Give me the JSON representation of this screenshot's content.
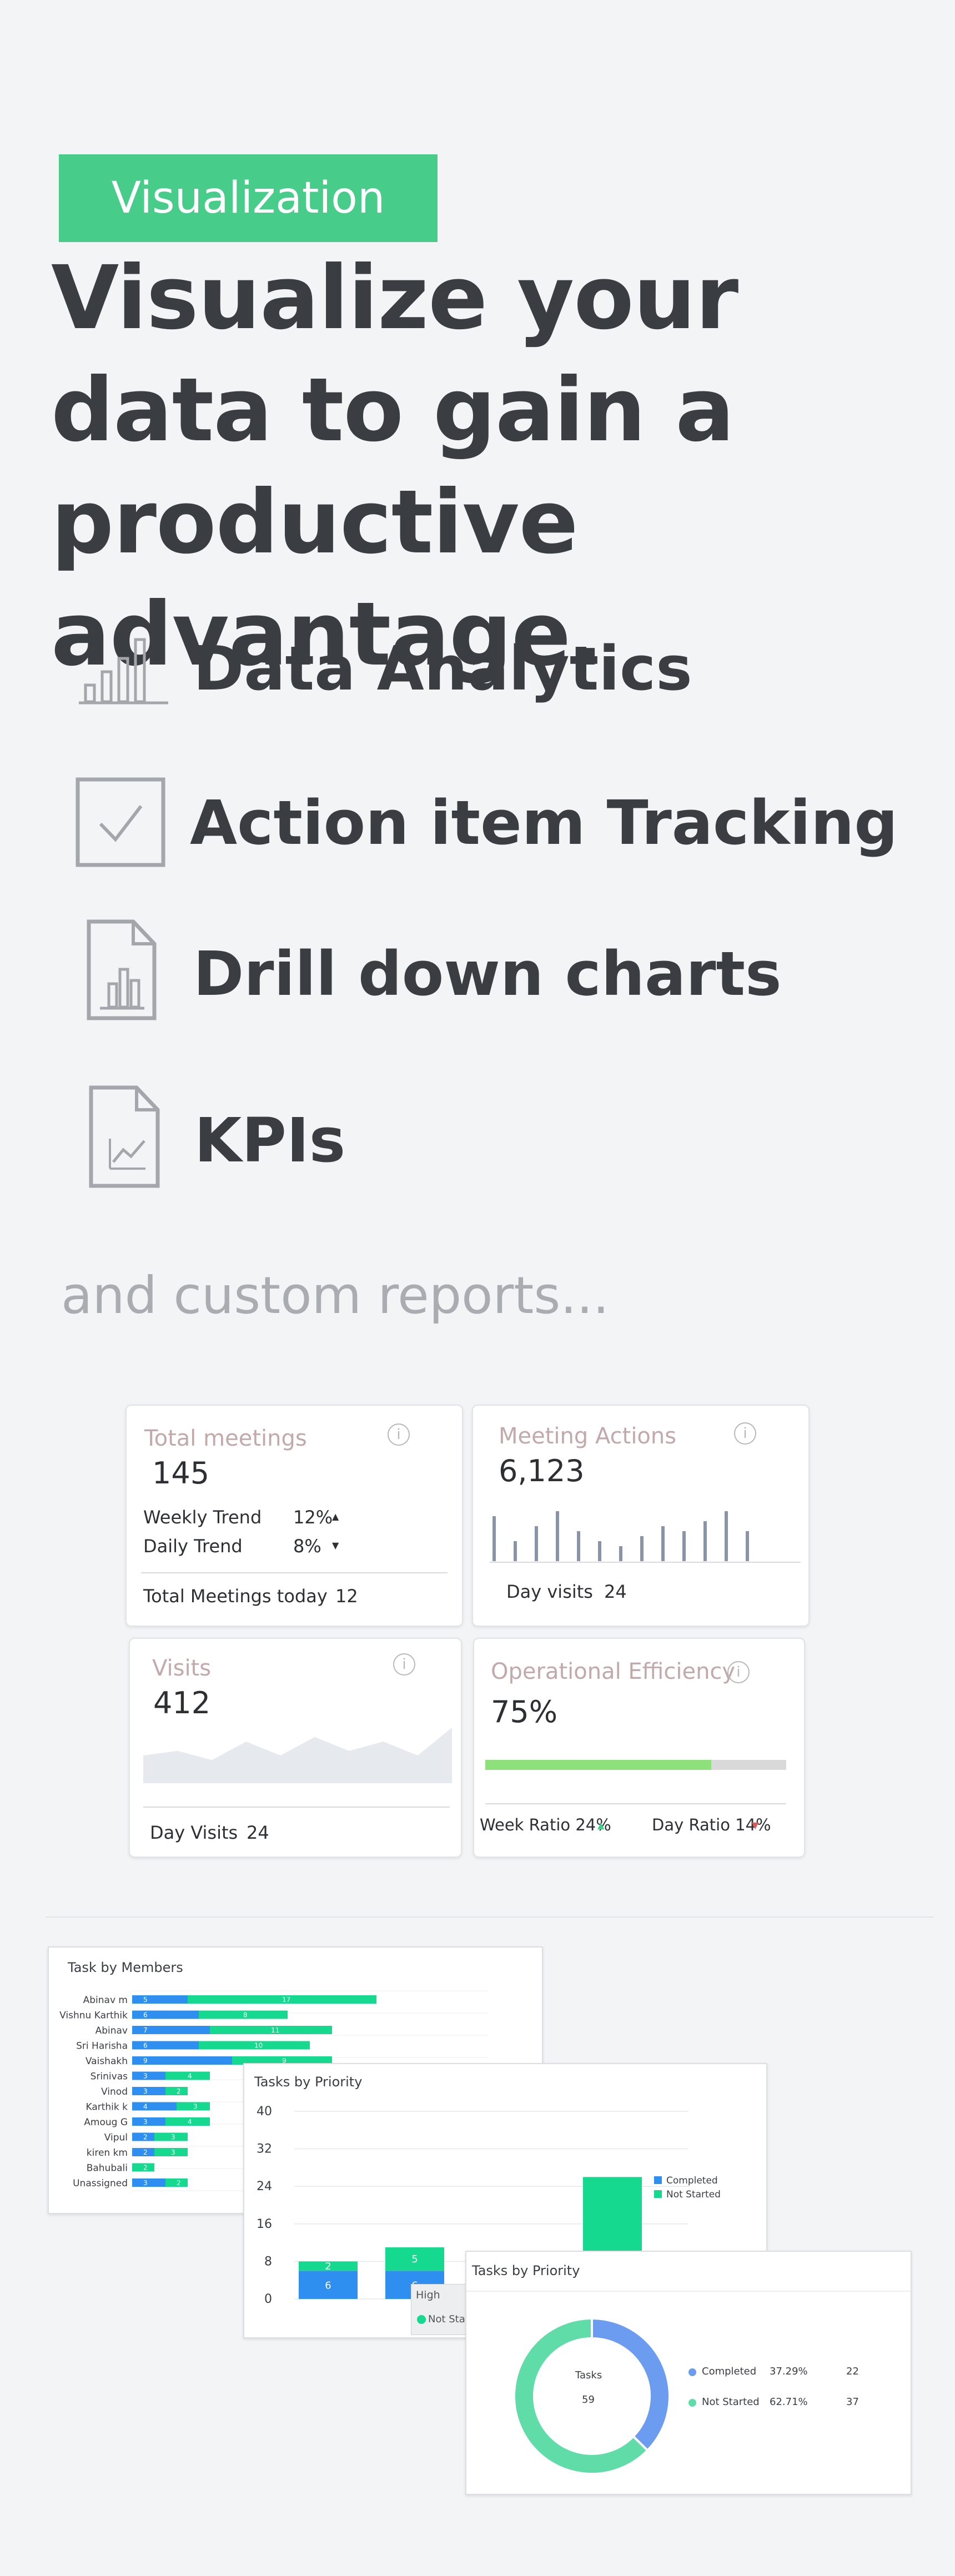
{
  "badge": "Visualization",
  "headline": "Visualize your data to gain a productive advantage.",
  "features": [
    {
      "icon": "bar-chart-icon",
      "label": "Data Analytics"
    },
    {
      "icon": "checkbox-icon",
      "label": "Action item Tracking"
    },
    {
      "icon": "document-bar-chart-icon",
      "label": "Drill down charts"
    },
    {
      "icon": "document-line-chart-icon",
      "label": "KPIs"
    }
  ],
  "tagline": "and custom reports...",
  "kpi": {
    "total_meetings": {
      "title": "Total meetings",
      "value": "145",
      "weekly_label": "Weekly Trend",
      "weekly_value": "12%",
      "weekly_dir": "▲",
      "daily_label": "Daily  Trend",
      "daily_value": "8%",
      "daily_dir": "▼",
      "today_label": "Total Meetings today",
      "today_value": "12"
    },
    "meeting_actions": {
      "title": "Meeting Actions",
      "value": "6,123",
      "footer_label": "Day visits",
      "footer_value": "24",
      "spark_values": [
        9,
        4,
        7,
        10,
        6,
        4,
        3,
        5,
        7,
        6,
        8,
        10,
        6
      ]
    },
    "visits": {
      "title": "Visits",
      "value": "412",
      "footer_label": "Day Visits",
      "footer_value": "24",
      "area_values": [
        6,
        7,
        5,
        9,
        6,
        10,
        7,
        9,
        6,
        12
      ]
    },
    "operational_efficiency": {
      "title": "Operational Efficiency",
      "value": "75%",
      "progress": 0.75,
      "week_ratio": "Week Ratio 24%",
      "week_dir": "▲",
      "day_ratio": "Day Ratio 14%",
      "day_dir": "▼"
    },
    "info_glyph": "i"
  },
  "colors": {
    "accent_green": "#47cc8a",
    "blue": "#2e8ff0",
    "teal": "#14d98f",
    "progress_green": "#8ee07a",
    "donut_blue": "#6c9cf0",
    "donut_green": "#5fdca8"
  },
  "task_by_members": {
    "title": "Task by Members",
    "rows": [
      {
        "name": "Abinav m",
        "completed": 5,
        "not_started": 17
      },
      {
        "name": "Vishnu Karthik",
        "completed": 6,
        "not_started": 8
      },
      {
        "name": "Abinav",
        "completed": 7,
        "not_started": 11
      },
      {
        "name": "Sri Harisha",
        "completed": 6,
        "not_started": 10
      },
      {
        "name": "Vaishakh",
        "completed": 9,
        "not_started": 9
      },
      {
        "name": "Srinivas",
        "completed": 3,
        "not_started": 4
      },
      {
        "name": "Vinod",
        "completed": 3,
        "not_started": 2
      },
      {
        "name": "Karthik k",
        "completed": 4,
        "not_started": 3
      },
      {
        "name": "Amoug G",
        "completed": 3,
        "not_started": 4
      },
      {
        "name": "Vipul",
        "completed": 2,
        "not_started": 3
      },
      {
        "name": "kiren km",
        "completed": 2,
        "not_started": 3
      },
      {
        "name": "Bahubali",
        "completed": 0,
        "not_started": 2
      },
      {
        "name": "Unassigned",
        "completed": 3,
        "not_started": 2
      }
    ]
  },
  "tasks_by_priority_bar": {
    "title": "Tasks by Priority",
    "y_ticks": [
      "40",
      "32",
      "24",
      "16",
      "8",
      "0"
    ],
    "legend": [
      "Completed",
      "Not Started"
    ],
    "bars": [
      {
        "completed": 6,
        "not_started": 2
      },
      {
        "completed": 6,
        "not_started": 5
      },
      {
        "completed": 0,
        "not_started": 26
      }
    ],
    "tooltip": {
      "label": "High",
      "series": "Not Started"
    }
  },
  "tasks_by_priority_donut": {
    "title": "Tasks by Priority",
    "center_label": "Tasks",
    "center_value": "59",
    "rows": [
      {
        "label": "Completed",
        "pct": "37.29%",
        "count": "22"
      },
      {
        "label": "Not Started",
        "pct": "62.71%",
        "count": "37"
      }
    ]
  }
}
